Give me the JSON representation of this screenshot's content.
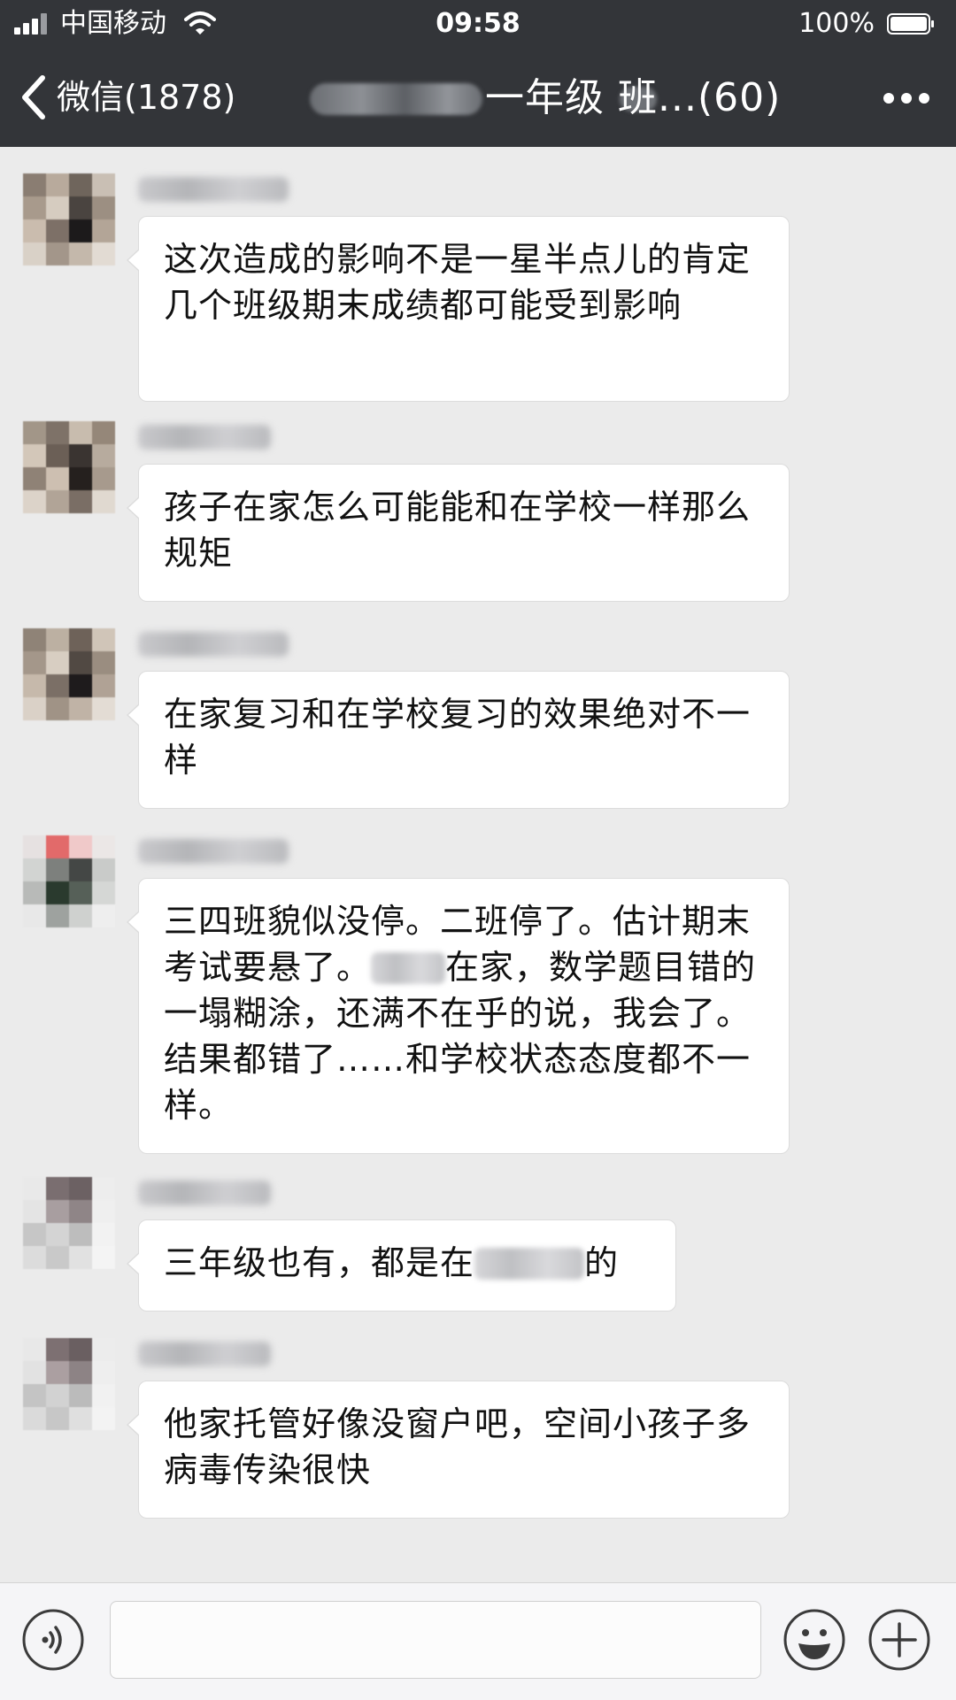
{
  "status_bar": {
    "carrier": "中国移动",
    "time": "09:58",
    "battery": "100%"
  },
  "nav": {
    "back_label": "微信(1878)",
    "title_visible": "一年级   班...(60)"
  },
  "messages": [
    {
      "text": "这次造成的影响不是一星半点儿的肯定几个班级期末成绩都可能受到影响"
    },
    {
      "text": "孩子在家怎么可能能和在学校一样那么规矩"
    },
    {
      "text": "在家复习和在学校复习的效果绝对不一样"
    },
    {
      "text_before": "三四班貌似没停。二班停了。估计期末考试要悬了。",
      "text_after": "在家，数学题目错的一塌糊涂，还满不在乎的说，我会了。结果都错了……和学校状态态度都不一样。"
    },
    {
      "text_before": "三年级也有，都是在",
      "text_after": "的"
    },
    {
      "text": "他家托管好像没窗户吧，空间小孩子多病毒传染很快"
    }
  ],
  "input_bar": {
    "voice_icon": "voice-icon",
    "emoji_icon": "emoji-icon",
    "plus_icon": "plus-icon",
    "text_value": ""
  }
}
